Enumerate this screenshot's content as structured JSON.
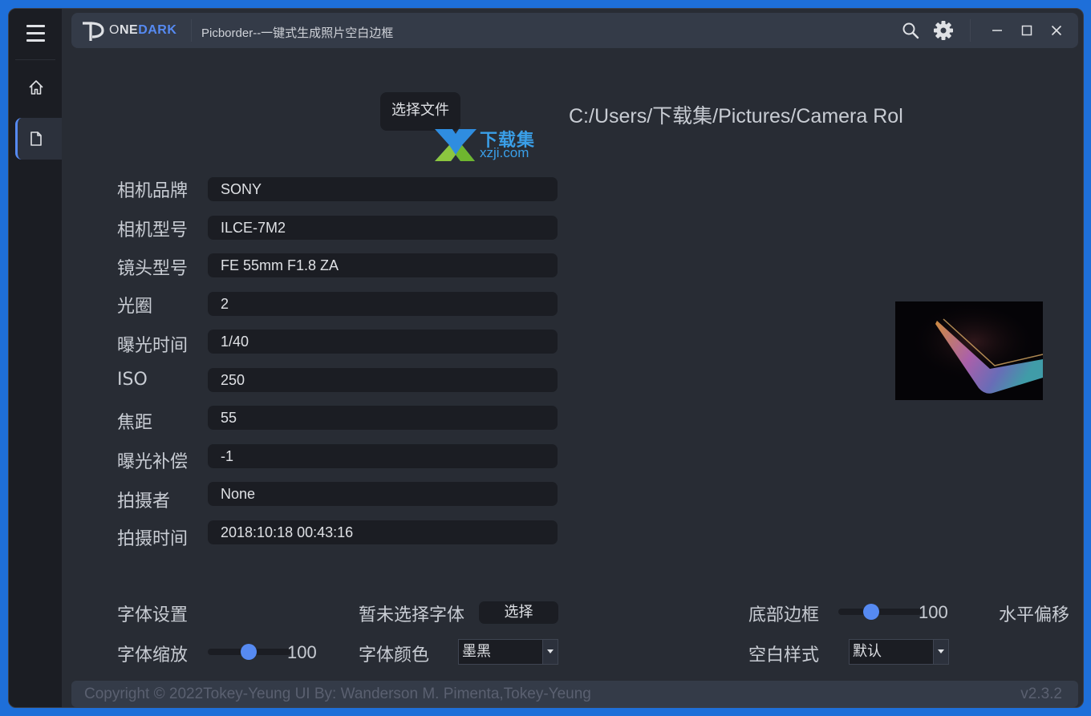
{
  "brand": {
    "prefix": "O",
    "name1": "NE",
    "name2": "DARK"
  },
  "app_title": "Picborder--一键式生成照片空白边框",
  "select_file_label": "选择文件",
  "path": "C:/Users/下载集/Pictures/Camera Rol",
  "watermark": {
    "title": "下载集",
    "url": "xzji.com"
  },
  "fields": [
    {
      "label": "相机品牌",
      "value": "SONY"
    },
    {
      "label": "相机型号",
      "value": "ILCE-7M2"
    },
    {
      "label": "镜头型号",
      "value": "FE 55mm F1.8 ZA"
    },
    {
      "label": "光圈",
      "value": "2"
    },
    {
      "label": "曝光时间",
      "value": "1/40"
    },
    {
      "label": "ISO",
      "value": "250"
    },
    {
      "label": "焦距",
      "value": "55"
    },
    {
      "label": "曝光补偿",
      "value": "-1"
    },
    {
      "label": "拍摄者",
      "value": "None"
    },
    {
      "label": "拍摄时间",
      "value": "2018:10:18 00:43:16"
    }
  ],
  "font_settings": {
    "label": "字体设置",
    "no_font_text": "暂未选择字体",
    "choose_btn": "选择",
    "scale_label": "字体缩放",
    "scale_value": "100",
    "color_label": "字体颜色",
    "color_value": "墨黑"
  },
  "border_settings": {
    "bottom_label": "底部边框",
    "bottom_value": "100",
    "horizontal_label": "水平偏移",
    "style_label": "空白样式",
    "style_value": "默认"
  },
  "footer": {
    "copyright": "Copyright © 2022Tokey-Yeung   UI By: Wanderson M. Pimenta,Tokey-Yeung",
    "version": "v2.3.2"
  },
  "colors": {
    "accent": "#568af2",
    "bg": "#282c34",
    "panel": "#1b1d23"
  },
  "icons": [
    "menu-icon",
    "home-icon",
    "file-icon",
    "search-icon",
    "gear-icon",
    "minimize-icon",
    "maximize-icon",
    "close-icon"
  ]
}
